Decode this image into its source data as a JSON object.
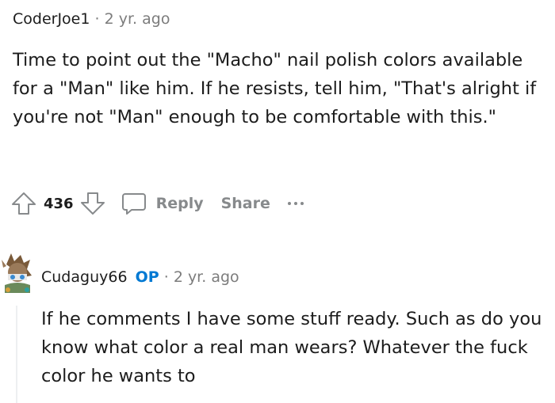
{
  "comment": {
    "username": "CoderJoe1",
    "separator": "·",
    "time": "2 yr. ago",
    "body": "Time to point out the \"Macho\" nail polish colors available for a \"Man\" like him. If he resists, tell him, \"That's alright if you're not \"Man\" enough to be comfortable with this.\"",
    "votes": "436",
    "reply_label": "Reply",
    "share_label": "Share"
  },
  "reply": {
    "username": "Cudaguy66",
    "badge": "OP",
    "separator": "·",
    "time": "2 yr. ago",
    "body": "If he comments I have some stuff ready. Such as do you know what color a real man wears? Whatever the fuck color he wants to"
  },
  "icons": {
    "upvote": "upvote-arrow-icon",
    "downvote": "downvote-arrow-icon",
    "reply": "speech-bubble-icon",
    "more": "ellipsis-icon"
  },
  "colors": {
    "text": "#1c1c1c",
    "muted": "#878a8c",
    "op_badge": "#0079d3",
    "thread_line": "#edeff1"
  }
}
